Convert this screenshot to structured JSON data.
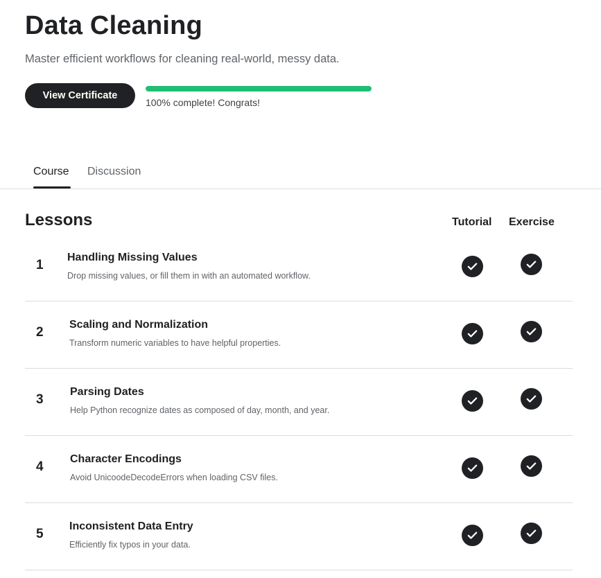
{
  "course": {
    "title": "Data Cleaning",
    "subtitle": "Master efficient workflows for cleaning real-world, messy data.",
    "certificate_button": "View Certificate",
    "progress_percent": 100,
    "progress_text": "100% complete! Congrats!",
    "progress_color": "#20be74"
  },
  "tabs": [
    {
      "label": "Course",
      "active": true
    },
    {
      "label": "Discussion",
      "active": false
    }
  ],
  "lessons_section": {
    "heading": "Lessons",
    "col_tutorial": "Tutorial",
    "col_exercise": "Exercise"
  },
  "lessons": [
    {
      "number": "1",
      "title": "Handling Missing Values",
      "description": "Drop missing values, or fill them in with an automated workflow.",
      "tutorial_icon": "check-circle-icon",
      "exercise_icon": "check-circle-icon"
    },
    {
      "number": "2",
      "title": "Scaling and Normalization",
      "description": "Transform numeric variables to have helpful properties.",
      "tutorial_icon": "check-circle-icon",
      "exercise_icon": "check-circle-icon"
    },
    {
      "number": "3",
      "title": "Parsing Dates",
      "description": "Help Python recognize dates as composed of day, month, and year.",
      "tutorial_icon": "check-circle-icon",
      "exercise_icon": "check-circle-icon"
    },
    {
      "number": "4",
      "title": "Character Encodings",
      "description": "Avoid UnicoodeDecodeErrors when loading CSV files.",
      "tutorial_icon": "check-circle-icon",
      "exercise_icon": "check-circle-icon"
    },
    {
      "number": "5",
      "title": "Inconsistent Data Entry",
      "description": "Efficiently fix typos in your data.",
      "tutorial_icon": "check-circle-icon",
      "exercise_icon": "check-circle-icon"
    }
  ]
}
